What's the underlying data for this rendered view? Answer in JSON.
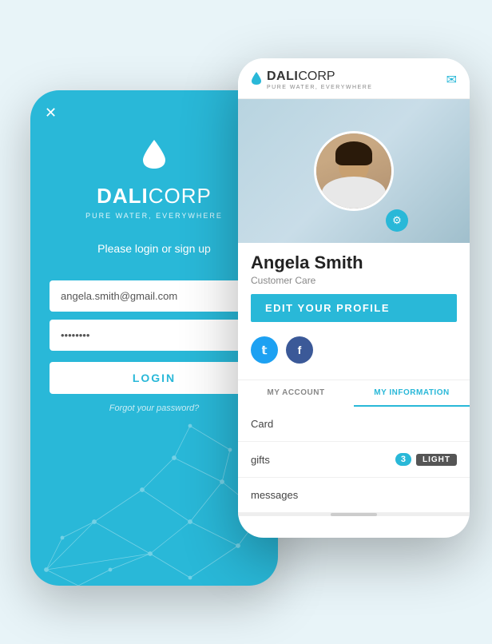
{
  "app": {
    "name": "DaliCorp",
    "brand": {
      "dali": "DALI",
      "corp": "CORP",
      "tagline": "PURE WATER, EVERYWHERE"
    }
  },
  "back_phone": {
    "close_label": "✕",
    "subtitle": "Please login or sign up",
    "email_placeholder": "angela.smith@gmail.com",
    "password_value": "••••••",
    "login_label": "LOGIN",
    "forgot_label": "Forgot your password?"
  },
  "front_phone": {
    "header": {
      "brand_dali": "DALI",
      "brand_corp": "CORP",
      "tagline": "PURE WATER, EVERYWHERE"
    },
    "profile": {
      "name": "Angela Smith",
      "role": "Customer Care",
      "edit_btn": "EDiT YOUR PROFILE"
    },
    "social": {
      "twitter_label": "t",
      "facebook_label": "f"
    },
    "tabs": [
      {
        "label": "MY ACCOUNT",
        "active": false
      },
      {
        "label": "MY INFORMATION",
        "active": true
      }
    ],
    "menu_items": [
      {
        "label": "Card",
        "badge": null,
        "tag": null
      },
      {
        "label": "gifts",
        "badge": "3",
        "tag": "LIGHT"
      },
      {
        "label": "messages",
        "badge": null,
        "tag": null
      }
    ]
  }
}
